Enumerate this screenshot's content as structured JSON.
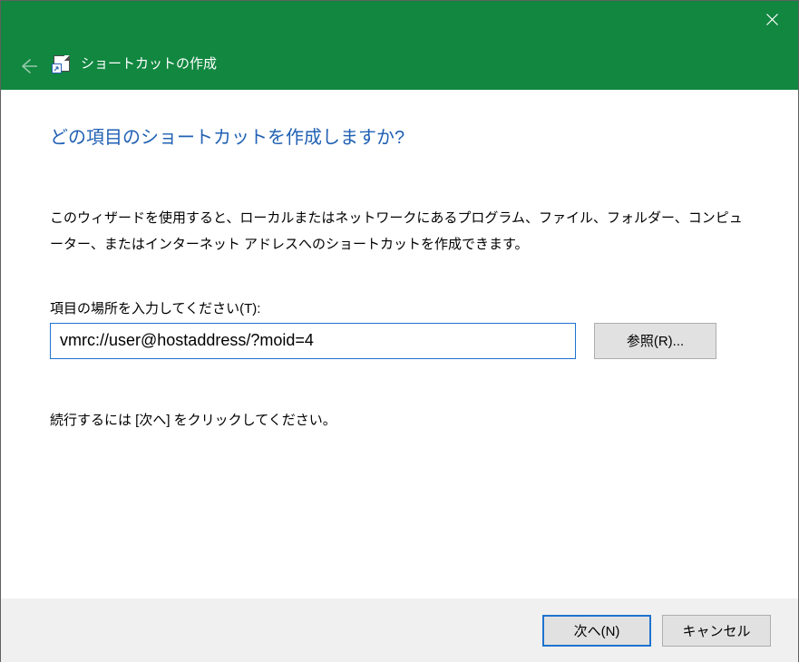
{
  "titlebar": {
    "title": "ショートカットの作成"
  },
  "main": {
    "heading": "どの項目のショートカットを作成しますか?",
    "description": "このウィザードを使用すると、ローカルまたはネットワークにあるプログラム、ファイル、フォルダー、コンピューター、またはインターネット アドレスへのショートカットを作成できます。",
    "field_label": "項目の場所を入力してください(T):",
    "path_value": "vmrc://user@hostaddress/?moid=4",
    "browse_label": "参照(R)...",
    "continue_hint": "続行するには [次へ] をクリックしてください。"
  },
  "footer": {
    "next_label": "次へ(N)",
    "cancel_label": "キャンセル"
  }
}
